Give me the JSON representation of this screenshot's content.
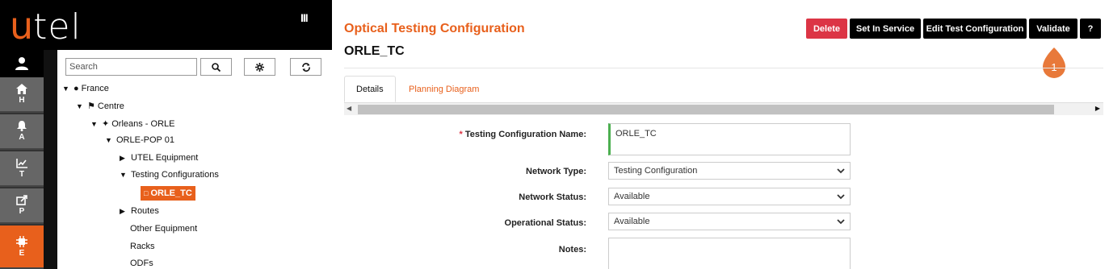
{
  "app": {
    "logo_u": "u",
    "logo_rest": "tel",
    "menu_toggle": "III"
  },
  "leftnav": {
    "items": [
      {
        "label": "H",
        "icon": "home-icon"
      },
      {
        "label": "A",
        "icon": "bell-icon"
      },
      {
        "label": "T",
        "icon": "chart-icon"
      },
      {
        "label": "P",
        "icon": "share-icon"
      },
      {
        "label": "E",
        "icon": "chip-icon",
        "active": true
      }
    ]
  },
  "tree": {
    "search_placeholder": "Search",
    "nodes": {
      "france": "France",
      "centre": "Centre",
      "orleans": "Orleans - ORLE",
      "orle_pop": "ORLE-POP 01",
      "utel_equipment": "UTEL Equipment",
      "testing_configurations": "Testing Configurations",
      "orle_tc": "ORLE_TC",
      "routes": "Routes",
      "other_equipment": "Other Equipment",
      "racks": "Racks",
      "odfs": "ODFs"
    }
  },
  "header": {
    "title": "Optical Testing Configuration",
    "record_name": "ORLE_TC"
  },
  "actions": {
    "delete": "Delete",
    "set_in_service": "Set In Service",
    "edit_test_configuration": "Edit Test Configuration",
    "validate": "Validate",
    "help": "?",
    "callout_number": "1"
  },
  "tabs": {
    "details": "Details",
    "planning_diagram": "Planning Diagram"
  },
  "form": {
    "required_mark": "*",
    "name_label": "Testing Configuration Name:",
    "name_value": "ORLE_TC",
    "network_type_label": "Network Type:",
    "network_type_value": "Testing Configuration",
    "network_status_label": "Network Status:",
    "network_status_value": "Available",
    "operational_status_label": "Operational Status:",
    "operational_status_value": "Available",
    "notes_label": "Notes:",
    "notes_value": ""
  },
  "colors": {
    "brand_orange": "#e8601c",
    "delete_red": "#dc3545",
    "valid_green": "#4caf50",
    "nav_gray": "#666666"
  }
}
